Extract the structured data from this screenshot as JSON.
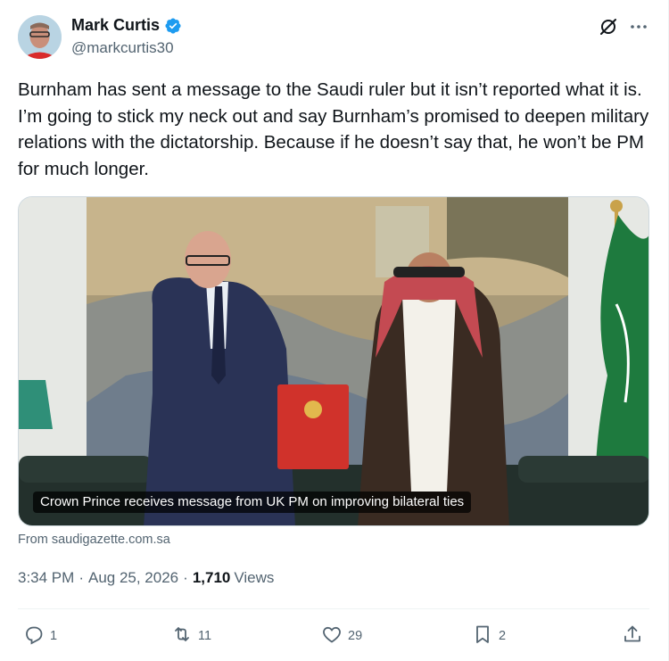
{
  "author": {
    "display_name": "Mark Curtis",
    "handle": "@markcurtis30",
    "verified_color": "#1d9bf0"
  },
  "tweet": {
    "text": "Burnham has sent a message to the Saudi ruler but it isn’t reported what it is.  I’m going to stick my neck out and say Burnham’s promised to deepen military relations with the dictatorship. Because if he doesn’t say that, he won’t be PM for much longer."
  },
  "media": {
    "caption": "Crown Prince receives message from UK PM on improving bilateral ties",
    "source": "From saudigazette.com.sa"
  },
  "meta": {
    "time": "3:34 PM",
    "date": "Aug 25, 2026",
    "views_count": "1,710",
    "views_label": "Views"
  },
  "actions": {
    "replies": "1",
    "reposts": "11",
    "likes": "29",
    "bookmarks": "2"
  },
  "icons": {
    "grok": "grok-icon",
    "more": "more-icon",
    "reply": "reply-icon",
    "repost": "repost-icon",
    "like": "like-icon",
    "bookmark": "bookmark-icon",
    "share": "share-icon"
  },
  "colors": {
    "text": "#0f1419",
    "secondary": "#536471",
    "border": "#eff3f4"
  }
}
